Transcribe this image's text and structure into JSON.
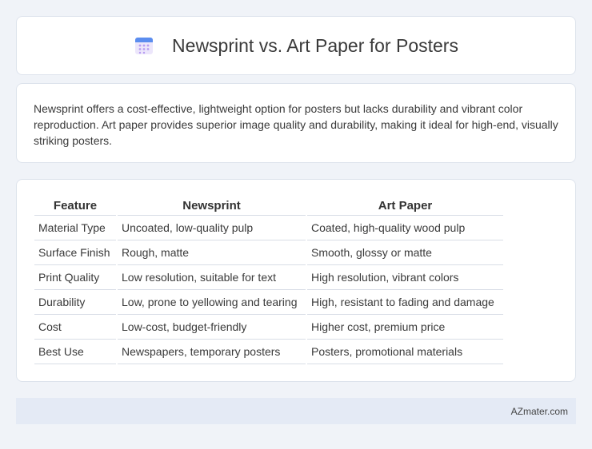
{
  "header": {
    "title": "Newsprint vs. Art Paper for Posters",
    "icon": "calendar-icon"
  },
  "intro": {
    "text": "Newsprint offers a cost-effective, lightweight option for posters but lacks durability and vibrant color reproduction. Art paper provides superior image quality and durability, making it ideal for high-end, visually striking posters."
  },
  "comparison": {
    "headers": [
      "Feature",
      "Newsprint",
      "Art Paper"
    ],
    "rows": [
      [
        "Material Type",
        "Uncoated, low-quality pulp",
        "Coated, high-quality wood pulp"
      ],
      [
        "Surface Finish",
        "Rough, matte",
        "Smooth, glossy or matte"
      ],
      [
        "Print Quality",
        "Low resolution, suitable for text",
        "High resolution, vibrant colors"
      ],
      [
        "Durability",
        "Low, prone to yellowing and tearing",
        "High, resistant to fading and damage"
      ],
      [
        "Cost",
        "Low-cost, budget-friendly",
        "Higher cost, premium price"
      ],
      [
        "Best Use",
        "Newspapers, temporary posters",
        "Posters, promotional materials"
      ]
    ]
  },
  "footer": {
    "brand": "AZmater.com"
  },
  "colors": {
    "background": "#f0f3f8",
    "footer": "#e4eaf5",
    "icon_blue": "#5b8def",
    "icon_purple": "#b79cf2"
  }
}
